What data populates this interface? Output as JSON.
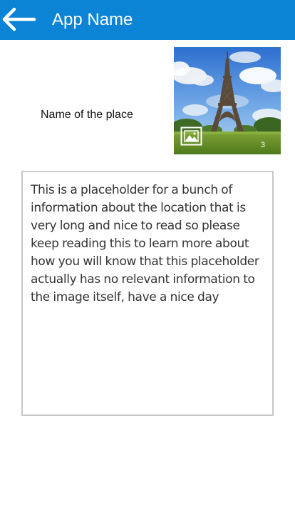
{
  "header": {
    "title": "App Name",
    "back_icon": "arrow-left-icon"
  },
  "place": {
    "name": "Name of the place",
    "photo_count": "3",
    "gallery_icon": "image-gallery-icon"
  },
  "info": {
    "text": "This is a placeholder for a bunch of information about the location that is very long and nice to read so please keep reading this to learn more about how you will know that this placeholder actually has no relevant information to the image itself, have a nice day"
  },
  "colors": {
    "app_bar": "#0b84d6",
    "title_text": "#ffffff",
    "box_border": "#c8c8c8",
    "body_text": "#333333"
  }
}
